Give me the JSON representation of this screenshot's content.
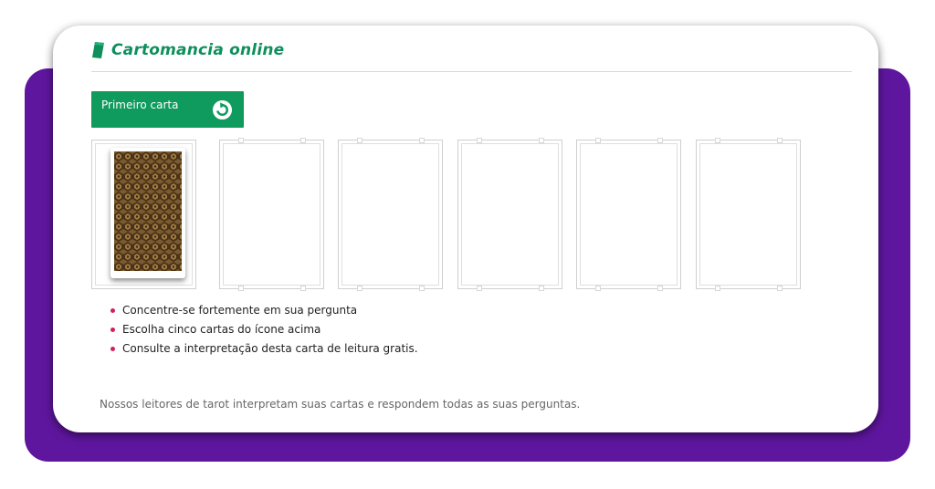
{
  "header": {
    "title": "Cartomancia online",
    "icon": "card-icon",
    "title_color": "#0f8f5c"
  },
  "draw_button": {
    "label": "Primeiro carta",
    "icon": "refresh-arrow-icon",
    "color": "#0f9a5e"
  },
  "card_slots": {
    "count": 6,
    "filled": [
      true,
      false,
      false,
      false,
      false,
      false
    ]
  },
  "instructions": [
    "Concentre-se fortemente em sua pergunta",
    "Escolha cinco cartas do ícone acima",
    "Consulte a interpretação desta carta de leitura gratis."
  ],
  "footer": {
    "text": "Nossos leitores de tarot interpretam suas cartas e respondem todas as suas perguntas."
  },
  "colors": {
    "background_accent": "#5f169f",
    "bullet": "#d0215a"
  }
}
